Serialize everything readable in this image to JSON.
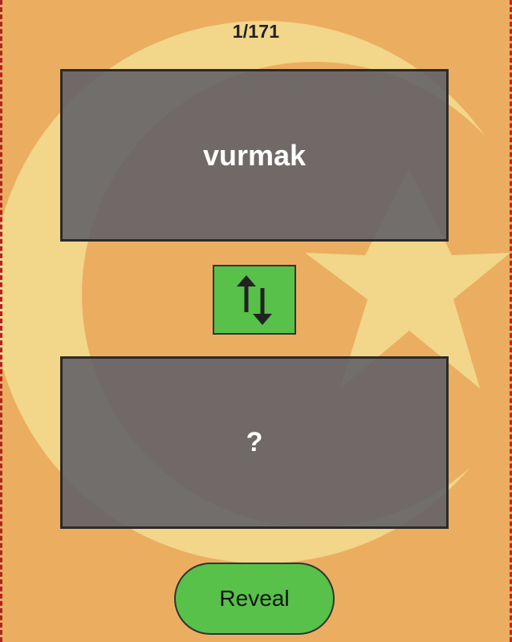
{
  "progress": {
    "counter_text": "1/171"
  },
  "cards": {
    "prompt_word": "vurmak",
    "answer_placeholder": "?"
  },
  "controls": {
    "swap_icon": "swap-vertical-arrows-icon",
    "reveal_label": "Reveal"
  },
  "colors": {
    "background": "#EBAE61",
    "emblem": "#F2D689",
    "card": "#5F6068",
    "button": "#57C14A"
  }
}
